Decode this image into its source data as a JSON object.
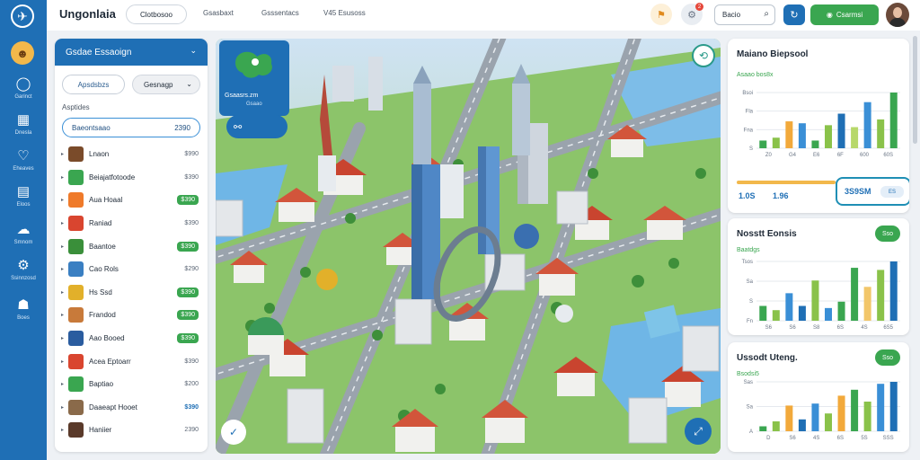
{
  "app": {
    "title": "Ungonlaia"
  },
  "topbar": {
    "pill": "Clotbosoo",
    "tabs": [
      "Gsasbaxt",
      "Gsssentacs",
      "V45 Esusoss"
    ],
    "search_value": "Bacio",
    "green_button": "Csarmsi",
    "notification_count": "2"
  },
  "rail": {
    "items": [
      {
        "icon": "chat-icon",
        "label": "Garinct"
      },
      {
        "icon": "grid-icon",
        "label": "Dnesla"
      },
      {
        "icon": "heart-icon",
        "label": "Eheaves"
      },
      {
        "icon": "calendar-icon",
        "label": "Eloos"
      },
      {
        "icon": "cloud-icon",
        "label": "Smnom"
      },
      {
        "icon": "settings-icon",
        "label": "Ssinnzosd"
      },
      {
        "icon": "people-icon",
        "label": "Boes"
      }
    ]
  },
  "left_panel": {
    "title": "Gsdae Essaoign",
    "filter_1": "Apsdsbzs",
    "filter_2": "Gesnagp",
    "section": "Asptides",
    "featured": {
      "label": "Baeontsaao",
      "value": "2390"
    },
    "items": [
      {
        "name": "Lnaon",
        "price": "$990",
        "price_style": "badge-plain",
        "thumb": "#7a4b2a"
      },
      {
        "name": "Beiajatfotoode",
        "price": "$390",
        "price_style": "plain",
        "thumb": "#3aa650"
      },
      {
        "name": "Aua Hoaal",
        "price": "$390",
        "price_style": "badge",
        "thumb": "#ef7a2a"
      },
      {
        "name": "Raniad",
        "price": "$390",
        "price_style": "plain",
        "thumb": "#d9452f"
      },
      {
        "name": "Baantoe",
        "price": "$390",
        "price_style": "badge",
        "thumb": "#3a8f3a"
      },
      {
        "name": "Cao Rols",
        "price": "$290",
        "price_style": "plain",
        "thumb": "#3a7fc2"
      },
      {
        "name": "Hs Ssd",
        "price": "$390",
        "price_style": "badge",
        "thumb": "#e2b02a"
      },
      {
        "name": "Frandod",
        "price": "$390",
        "price_style": "badge",
        "thumb": "#c87a3a"
      },
      {
        "name": "Aao Booed",
        "price": "$390",
        "price_style": "badge",
        "thumb": "#2a5c9f"
      },
      {
        "name": "Acea Eptoarr",
        "price": "$390",
        "price_style": "plain",
        "thumb": "#d9452f"
      },
      {
        "name": "Baptiao",
        "price": "$200",
        "price_style": "plain",
        "thumb": "#3aa650"
      },
      {
        "name": "Daaeapt Hooet",
        "price": "$390",
        "price_style": "blue",
        "thumb": "#8a6a4a"
      },
      {
        "name": "Haniier",
        "price": "2390",
        "price_style": "plain",
        "thumb": "#5a3a2a"
      }
    ]
  },
  "map": {
    "card_title": "Gsaasrs.zm",
    "card_sub": "Gsaao"
  },
  "cards": [
    {
      "title": "Maiano Biepsool",
      "sub": "Asaao bos8x",
      "chart_data": {
        "type": "bar",
        "ylabels": [
          "Bsoi",
          "Fla",
          "Fna",
          "S"
        ],
        "xlabels": [
          "Z0",
          "G4",
          "E6",
          "6F",
          "600",
          "60S"
        ],
        "values": [
          8,
          11,
          28,
          26,
          8,
          24,
          36,
          22,
          48,
          30,
          58
        ],
        "colors": [
          "#3aa650",
          "#8ac24a",
          "#f2a93b",
          "#3a8fd6",
          "#3aa650",
          "#8ac24a",
          "#1f6fb5",
          "#b7d86a",
          "#3a8fd6",
          "#8ac24a",
          "#3aa650"
        ]
      },
      "stats": {
        "a": "1.0S",
        "b": "1.96",
        "box": "3S9SM",
        "box_pill": "ES"
      }
    },
    {
      "title": "Nosstt Eonsis",
      "badge": "Sso",
      "sub": "Baatdgs",
      "chart_data": {
        "type": "bar",
        "ylabels": [
          "Tsos",
          "Sa",
          "S",
          "Fn"
        ],
        "xlabels": [
          "S6",
          "S6",
          "S8",
          "6S",
          "4S",
          "6S5"
        ],
        "values": [
          14,
          10,
          26,
          14,
          38,
          12,
          18,
          50,
          32,
          48,
          56
        ],
        "colors": [
          "#3aa650",
          "#8ac24a",
          "#3a8fd6",
          "#1f6fb5",
          "#8ac24a",
          "#3a8fd6",
          "#3aa650",
          "#3aa650",
          "#f2c66a",
          "#8ac24a",
          "#1f6fb5"
        ]
      }
    },
    {
      "title": "Ussodt Uteng.",
      "badge": "Sso",
      "sub": "Bsodsi5",
      "chart_data": {
        "type": "bar",
        "ylabels": [
          "Sas",
          "Sa",
          "A"
        ],
        "xlabels": [
          "D",
          "S6",
          "4S",
          "6S",
          "5S",
          "SSS"
        ],
        "values": [
          5,
          10,
          26,
          12,
          28,
          18,
          36,
          42,
          30,
          48,
          50
        ],
        "colors": [
          "#3aa650",
          "#8ac24a",
          "#f2a93b",
          "#1f6fb5",
          "#3a8fd6",
          "#8ac24a",
          "#f2a93b",
          "#3aa650",
          "#8ac24a",
          "#3a8fd6",
          "#1f6fb5"
        ]
      }
    }
  ]
}
